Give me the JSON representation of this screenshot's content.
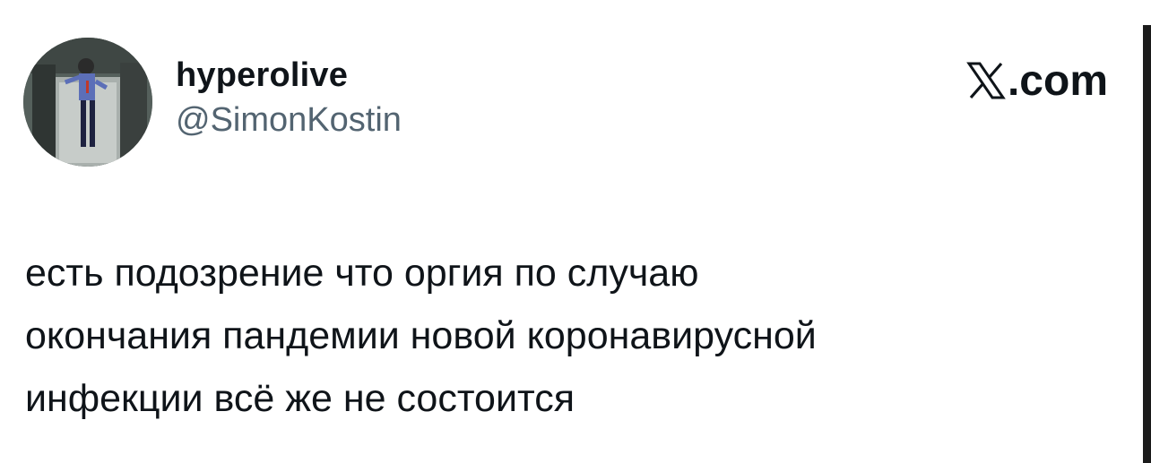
{
  "tweet": {
    "author": {
      "display_name": "hyperolive",
      "handle": "@SimonKostin",
      "avatar_icon": "profile-photo"
    },
    "brand": {
      "logo_icon": "x-logo-icon",
      "text": ".com"
    },
    "text": "есть подозрение что оргия по случаю\nокончания пандемии новой коронавирусной\nинфекции всё же не состоится"
  },
  "colors": {
    "text_primary": "#0f1419",
    "text_secondary": "#536471",
    "background": "#ffffff"
  }
}
